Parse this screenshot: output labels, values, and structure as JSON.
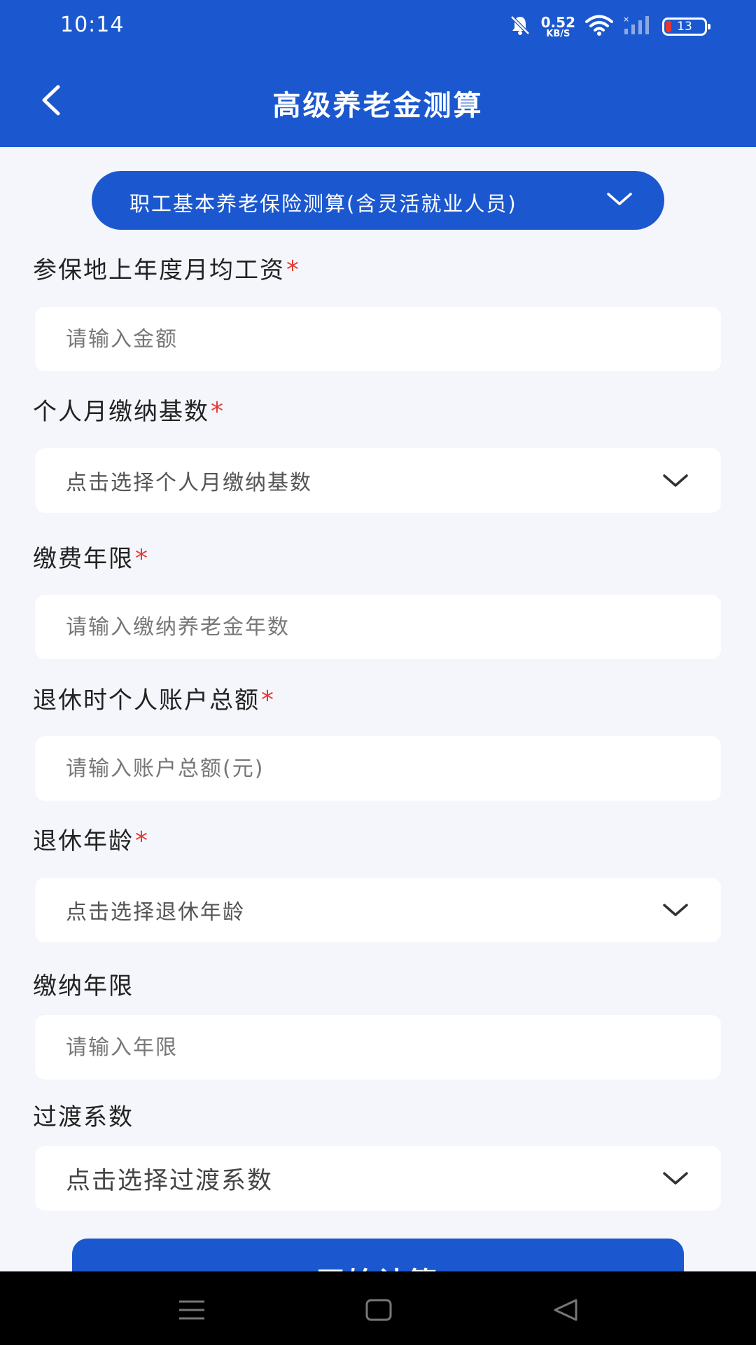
{
  "status_bar": {
    "time": "10:14",
    "net_speed_value": "0.52",
    "net_speed_unit": "KB/S",
    "battery_level": "13",
    "icons": [
      "mute-bell-icon",
      "wifi-icon",
      "signal-icon",
      "battery-icon"
    ]
  },
  "header": {
    "title": "高级养老金测算",
    "back_icon": "chevron-left-icon"
  },
  "type_selector": {
    "label": "职工基本养老保险测算(含灵活就业人员)"
  },
  "fields": {
    "avg_wage": {
      "label": "参保地上年度月均工资",
      "required_mark": "*",
      "placeholder": "请输入金额"
    },
    "base": {
      "label": "个人月缴纳基数",
      "required_mark": "*",
      "placeholder": "点击选择个人月缴纳基数"
    },
    "years": {
      "label": "缴费年限",
      "required_mark": "*",
      "placeholder": "请输入缴纳养老金年数"
    },
    "account": {
      "label": "退休时个人账户总额",
      "required_mark": "*",
      "placeholder": "请输入账户总额(元)"
    },
    "retire_age": {
      "label": "退休年龄",
      "required_mark": "*",
      "placeholder": "点击选择退休年龄"
    },
    "pay_years": {
      "label": "缴纳年限",
      "placeholder": "请输入年限"
    },
    "transition": {
      "label": "过渡系数",
      "placeholder": "点击选择过渡系数"
    }
  },
  "calc_button": {
    "label": "开始计算"
  },
  "colors": {
    "primary": "#1b58cf",
    "required": "#e53935",
    "background": "#f4f6fb"
  }
}
